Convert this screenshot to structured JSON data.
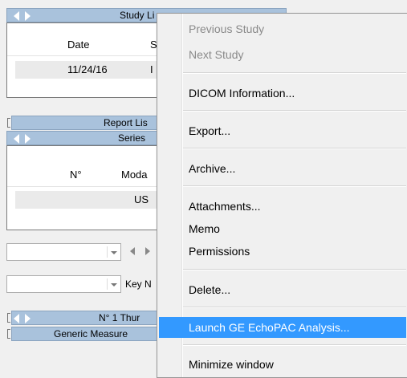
{
  "study_list": {
    "title": "Study Li",
    "col_date": "Date",
    "col2": "S",
    "row_date": "11/24/16",
    "row_col2": "I"
  },
  "report_list": {
    "title": "Report Lis"
  },
  "series": {
    "title": "Series",
    "col_num": "N°",
    "col_modality": "Moda",
    "row_modality": "US"
  },
  "key_label": "Key N",
  "thumbnails": {
    "title": "N° 1 Thur"
  },
  "generic_measure": {
    "title": "Generic Measure"
  },
  "context_menu": {
    "previous_study": "Previous Study",
    "next_study": "Next Study",
    "dicom_info": "DICOM Information...",
    "export": "Export...",
    "archive": "Archive...",
    "attachments": "Attachments...",
    "memo": "Memo",
    "permissions": "Permissions",
    "delete": "Delete...",
    "launch_echopac": "Launch GE EchoPAC Analysis...",
    "minimize": "Minimize window"
  },
  "colors": {
    "header_blue": "#a9c2dc",
    "highlight": "#3399ff"
  }
}
